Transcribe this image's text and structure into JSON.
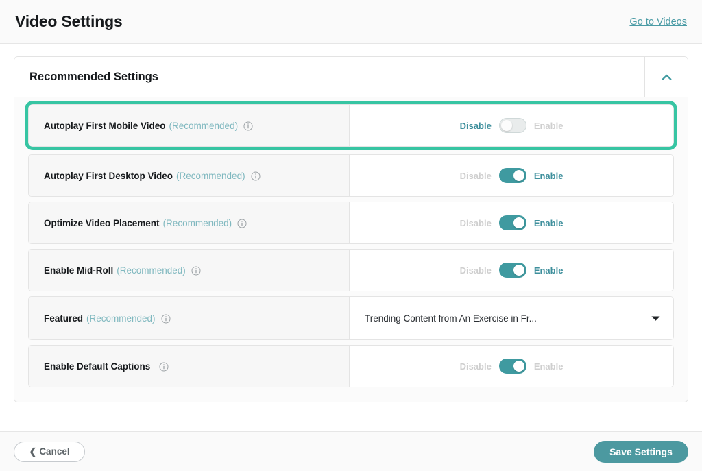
{
  "header": {
    "title": "Video Settings",
    "link_label": "Go to Videos"
  },
  "panel": {
    "title": "Recommended Settings",
    "collapse_icon": "chevron-up-icon",
    "rows": [
      {
        "label": "Autoplay First Mobile Video",
        "recommended": "(Recommended)",
        "info_icon": "info-icon",
        "control": "toggle",
        "disable_label": "Disable",
        "enable_label": "Enable",
        "state": "off",
        "highlighted": true
      },
      {
        "label": "Autoplay First Desktop Video",
        "recommended": "(Recommended)",
        "info_icon": "info-icon",
        "control": "toggle",
        "disable_label": "Disable",
        "enable_label": "Enable",
        "state": "on",
        "highlighted": false
      },
      {
        "label": "Optimize Video Placement",
        "recommended": "(Recommended)",
        "info_icon": "info-icon",
        "control": "toggle",
        "disable_label": "Disable",
        "enable_label": "Enable",
        "state": "on",
        "highlighted": false
      },
      {
        "label": "Enable Mid-Roll",
        "recommended": "(Recommended)",
        "info_icon": "info-icon",
        "control": "toggle",
        "disable_label": "Disable",
        "enable_label": "Enable",
        "state": "on",
        "highlighted": false
      },
      {
        "label": "Featured",
        "recommended": "(Recommended)",
        "info_icon": "info-icon",
        "control": "dropdown",
        "value": "Trending Content from An Exercise in Fr...",
        "dropdown_icon": "chevron-down-icon",
        "highlighted": false
      },
      {
        "label": "Enable Default Captions",
        "recommended": "",
        "info_icon": "info-icon",
        "control": "toggle",
        "disable_label": "Disable",
        "enable_label": "Enable",
        "state": "on",
        "highlighted": false
      }
    ]
  },
  "footer": {
    "cancel_label": "Cancel",
    "cancel_icon": "chevron-left-icon",
    "save_label": "Save Settings"
  },
  "colors": {
    "accent_teal": "#4c99a0",
    "highlight_green": "#37c5a3",
    "link_teal": "#4a9ba5",
    "recommended_text": "#7fb8bf",
    "muted_gray": "#cfcfcf"
  }
}
